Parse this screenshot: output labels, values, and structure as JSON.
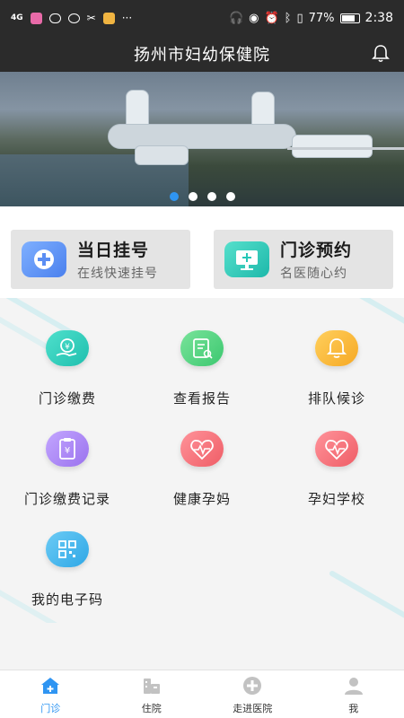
{
  "status_bar": {
    "network": "4G",
    "battery_text": "77%",
    "time": "2:38"
  },
  "header": {
    "title": "扬州市妇幼保健院"
  },
  "banner": {
    "slide_count": 4,
    "active_index": 0
  },
  "quick_cards": [
    {
      "title": "当日挂号",
      "subtitle": "在线快速挂号",
      "icon": "plus-icon",
      "color": "#5b8ef3"
    },
    {
      "title": "门诊预约",
      "subtitle": "名医随心约",
      "icon": "monitor-icon",
      "color": "#25c7b7"
    }
  ],
  "services": [
    {
      "label": "门诊缴费",
      "icon": "payment-hand-icon",
      "color": "#26c9b7"
    },
    {
      "label": "查看报告",
      "icon": "report-search-icon",
      "color": "#4fd27e"
    },
    {
      "label": "排队候诊",
      "icon": "bell-icon",
      "color": "#f9b53a"
    },
    {
      "label": "门诊缴费记录",
      "icon": "payment-record-icon",
      "color": "#ab86f2"
    },
    {
      "label": "健康孕妈",
      "icon": "heart-pulse-icon",
      "color": "#f5737a"
    },
    {
      "label": "孕妇学校",
      "icon": "heart-pulse-icon",
      "color": "#f5737a"
    },
    {
      "label": "我的电子码",
      "icon": "qr-code-icon",
      "color": "#43b4ec"
    }
  ],
  "tabs": [
    {
      "label": "门诊",
      "icon": "home-plus-icon",
      "active": true
    },
    {
      "label": "住院",
      "icon": "hospital-bed-icon",
      "active": false
    },
    {
      "label": "走进医院",
      "icon": "hospital-cross-icon",
      "active": false
    },
    {
      "label": "我",
      "icon": "person-icon",
      "active": false
    }
  ],
  "colors": {
    "accent": "#2f95f2",
    "header_bg": "#2b2b2b",
    "inactive_icon": "#c2c2c2"
  }
}
